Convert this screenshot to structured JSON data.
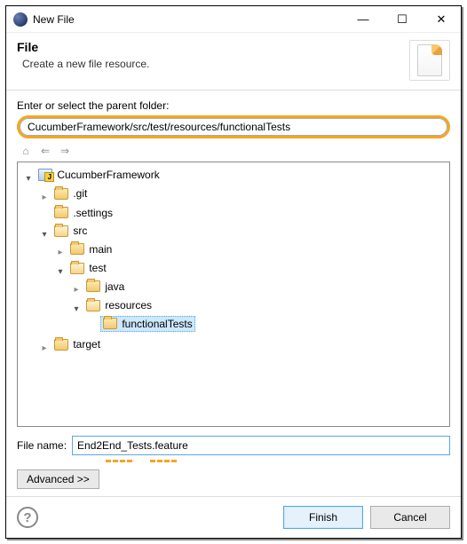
{
  "window": {
    "title": "New File"
  },
  "banner": {
    "heading": "File",
    "description": "Create a new file resource."
  },
  "parent_folder": {
    "label": "Enter or select the parent folder:",
    "value": "CucumberFramework/src/test/resources/functionalTests"
  },
  "tree": {
    "root": "CucumberFramework",
    "git": ".git",
    "settings": ".settings",
    "src": "src",
    "main": "main",
    "test": "test",
    "java": "java",
    "resources": "resources",
    "functionalTests": "functionalTests",
    "target": "target"
  },
  "filename": {
    "label": "File name:",
    "value": "End2End_Tests.feature"
  },
  "buttons": {
    "advanced": "Advanced >>",
    "finish": "Finish",
    "cancel": "Cancel"
  }
}
